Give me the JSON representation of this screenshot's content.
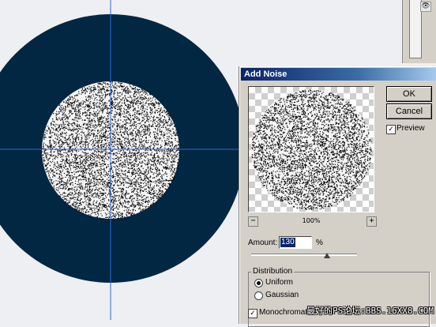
{
  "canvas": {
    "background_color": "#edeff2",
    "circle_color": "#022743",
    "noise_dark_color": "#0b0b0b",
    "noise_light_color": "#f4f4f4",
    "guide_color": "#2f66d8"
  },
  "panel": {
    "visibility_icon": "eye-icon",
    "eye_glyph": "👁"
  },
  "dialog": {
    "title": "Add Noise",
    "ok_label": "OK",
    "cancel_label": "Cancel",
    "preview_label": "Preview",
    "preview_checked": true,
    "check_glyph": "✓",
    "zoom_out_glyph": "−",
    "zoom_in_glyph": "+",
    "zoom_level": "100%",
    "amount_label": "Amount:",
    "amount_value": "130",
    "amount_unit": "%",
    "amount_slider_fraction": 0.72,
    "distribution_legend": "Distribution",
    "distribution_options": [
      "Uniform",
      "Gaussian"
    ],
    "distribution_selected": "Uniform",
    "monochromatic_label": "Monochromatic",
    "monochromatic_checked": true
  },
  "watermark": {
    "text": "最好的PS论坛:BBS.16XX8.COM"
  }
}
